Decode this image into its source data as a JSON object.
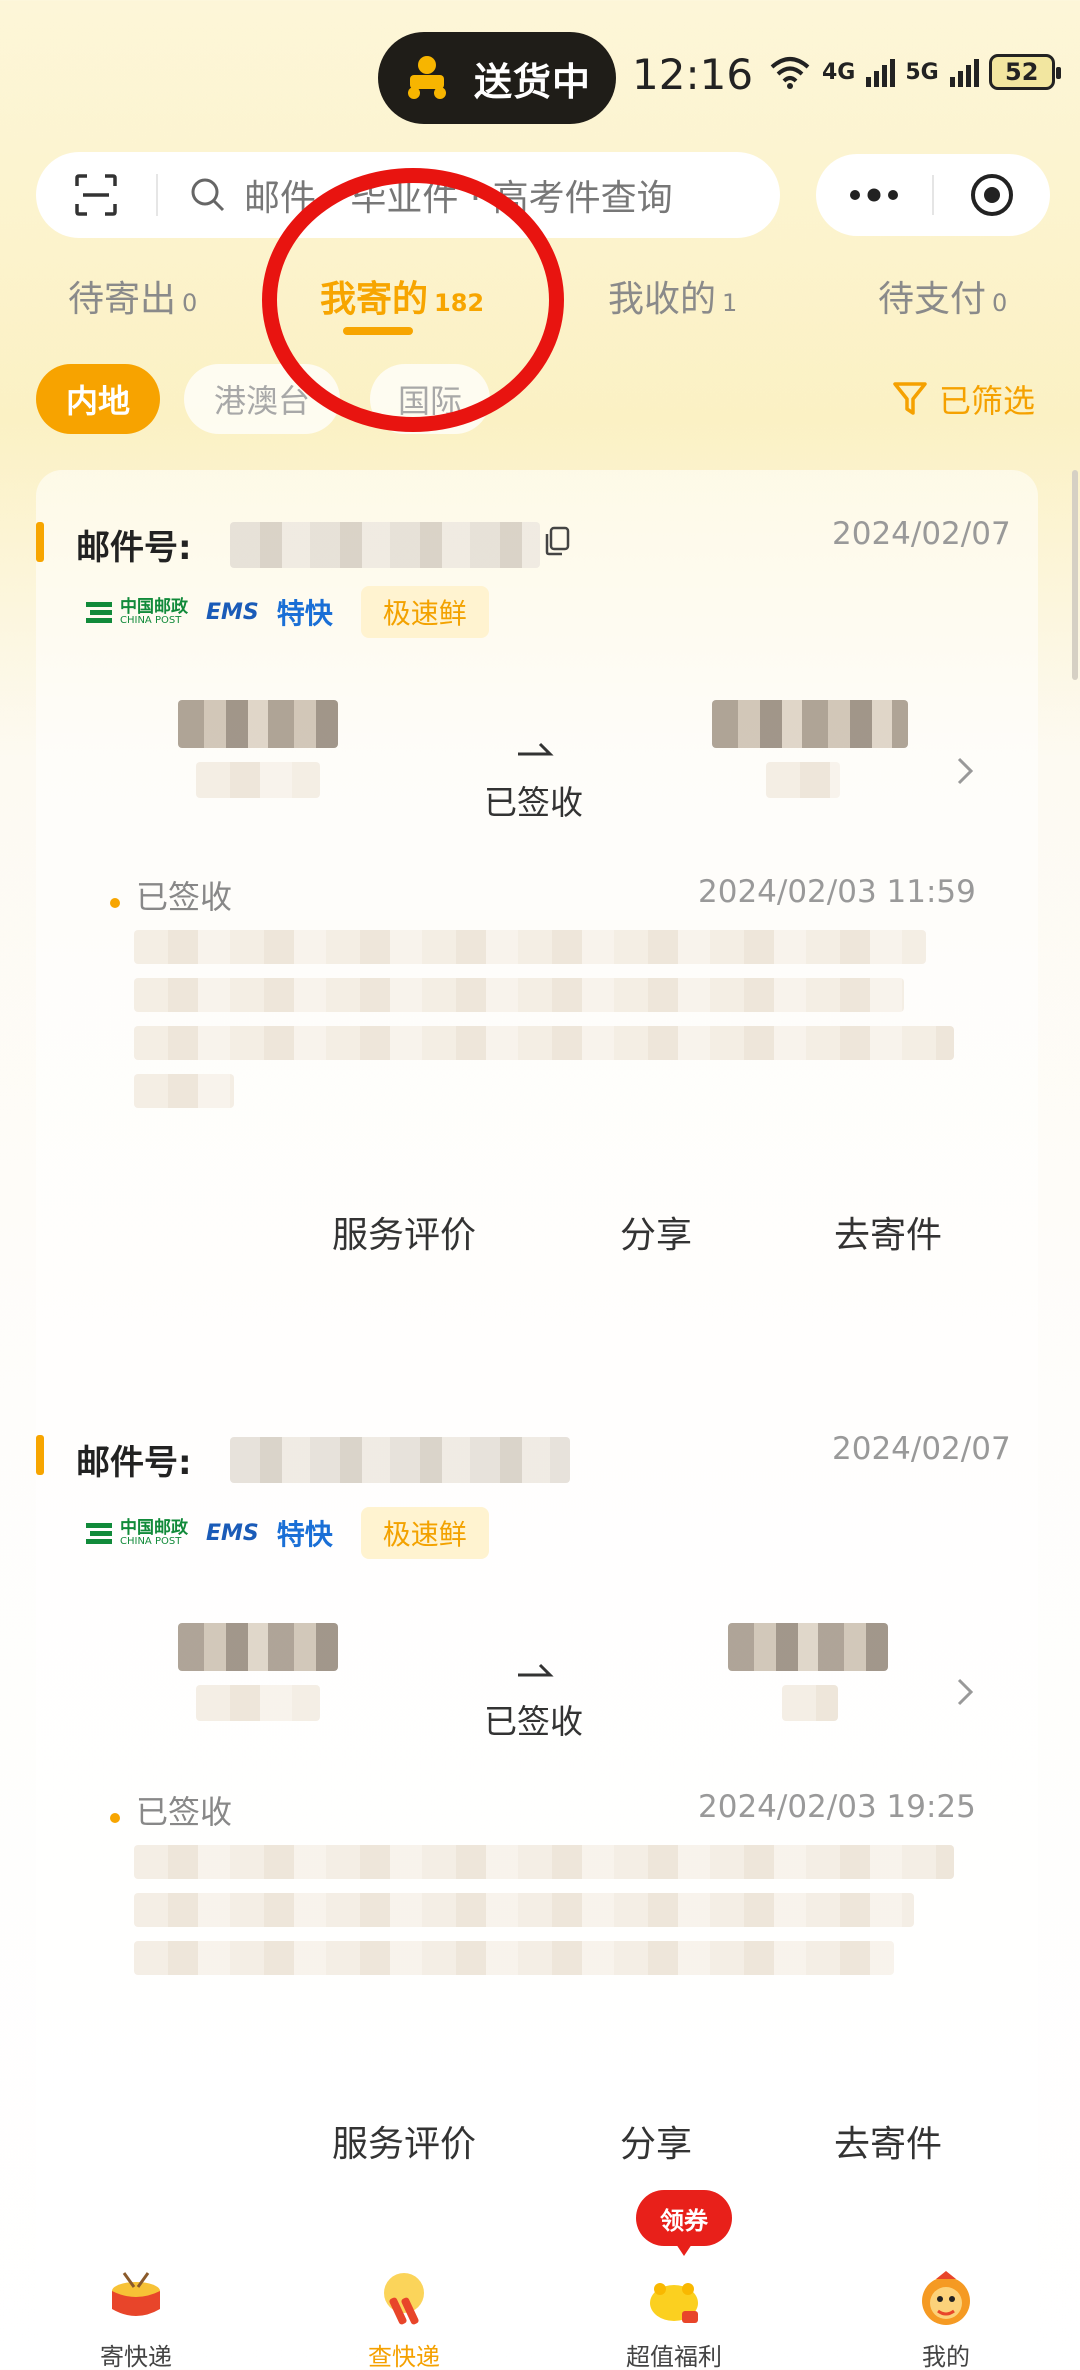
{
  "status_bar": {
    "pill_text": "送货中",
    "time": "12:16",
    "net1": "4G",
    "net2": "5G",
    "battery": "52"
  },
  "search": {
    "placeholder": "邮件 · 毕业件 · 高考件查询"
  },
  "tabs": [
    {
      "label": "待寄出",
      "count": "0"
    },
    {
      "label": "我寄的",
      "count": "182"
    },
    {
      "label": "我收的",
      "count": "1"
    },
    {
      "label": "待支付",
      "count": "0"
    }
  ],
  "regions": [
    "内地",
    "港澳台",
    "国际"
  ],
  "filter_label": "已筛选",
  "cards": [
    {
      "mail_label": "邮件号:",
      "date": "2024/02/07",
      "brand_cn": "中国邮政",
      "brand_en": "CHINA POST",
      "ems": "EMS",
      "tekuai": "特快",
      "tag": "极速鲜",
      "status": "已签收",
      "track_status": "已签收",
      "track_time": "2024/02/03 11:59",
      "actions": [
        "服务评价",
        "分享",
        "去寄件"
      ]
    },
    {
      "mail_label": "邮件号:",
      "date": "2024/02/07",
      "brand_cn": "中国邮政",
      "brand_en": "CHINA POST",
      "ems": "EMS",
      "tekuai": "特快",
      "tag": "极速鲜",
      "status": "已签收",
      "track_status": "已签收",
      "track_time": "2024/02/03 19:25",
      "actions": [
        "服务评价",
        "分享",
        "去寄件"
      ]
    }
  ],
  "nav": [
    {
      "label": "寄快递"
    },
    {
      "label": "查快递"
    },
    {
      "label": "超值福利"
    },
    {
      "label": "我的"
    }
  ],
  "coupon": "领券",
  "colors": {
    "accent": "#f7a500",
    "annotation": "#e81410"
  }
}
